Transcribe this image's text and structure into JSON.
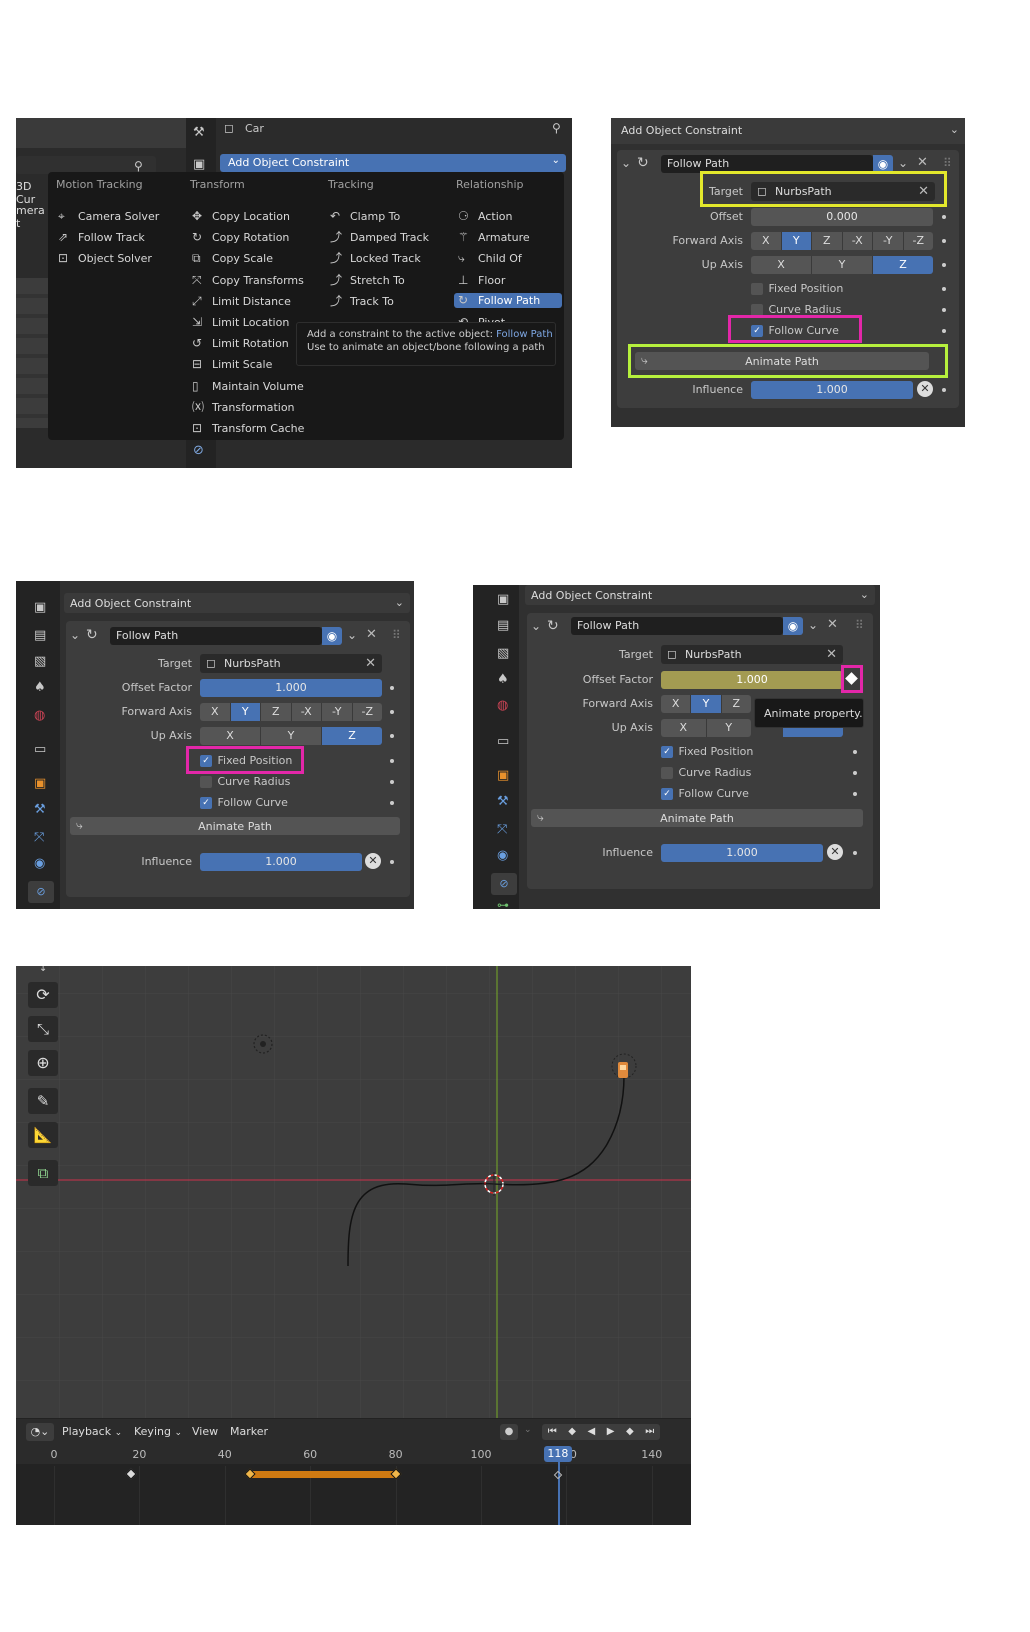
{
  "panel1": {
    "object_name": "Car",
    "menu_title": "Add Object Constraint",
    "left_labels": [
      "3D Cur",
      "mera t"
    ],
    "columns": [
      {
        "title": "Motion Tracking",
        "items": [
          {
            "label": "Camera Solver",
            "icon": "camera-solver-icon",
            "glyph": "⌖"
          },
          {
            "label": "Follow Track",
            "icon": "follow-track-icon",
            "glyph": "⇗"
          },
          {
            "label": "Object Solver",
            "icon": "object-solver-icon",
            "glyph": "⊡"
          }
        ]
      },
      {
        "title": "Transform",
        "items": [
          {
            "label": "Copy Location",
            "icon": "copy-location-icon",
            "glyph": "✥"
          },
          {
            "label": "Copy Rotation",
            "icon": "copy-rotation-icon",
            "glyph": "↻"
          },
          {
            "label": "Copy Scale",
            "icon": "copy-scale-icon",
            "glyph": "⧉"
          },
          {
            "label": "Copy Transforms",
            "icon": "copy-transforms-icon",
            "glyph": "⤧"
          },
          {
            "label": "Limit Distance",
            "icon": "limit-distance-icon",
            "glyph": "⤢"
          },
          {
            "label": "Limit Location",
            "icon": "limit-location-icon",
            "glyph": "⇲"
          },
          {
            "label": "Limit Rotation",
            "icon": "limit-rotation-icon",
            "glyph": "↺"
          },
          {
            "label": "Limit Scale",
            "icon": "limit-scale-icon",
            "glyph": "⊟"
          },
          {
            "label": "Maintain Volume",
            "icon": "maintain-volume-icon",
            "glyph": "▯"
          },
          {
            "label": "Transformation",
            "icon": "transformation-icon",
            "glyph": "⒳"
          },
          {
            "label": "Transform Cache",
            "icon": "transform-cache-icon",
            "glyph": "⊡"
          }
        ]
      },
      {
        "title": "Tracking",
        "items": [
          {
            "label": "Clamp To",
            "icon": "clamp-to-icon",
            "glyph": "↶"
          },
          {
            "label": "Damped Track",
            "icon": "damped-track-icon",
            "glyph": "⤴"
          },
          {
            "label": "Locked Track",
            "icon": "locked-track-icon",
            "glyph": "⤴"
          },
          {
            "label": "Stretch To",
            "icon": "stretch-to-icon",
            "glyph": "⤴"
          },
          {
            "label": "Track To",
            "icon": "track-to-icon",
            "glyph": "⤴"
          }
        ]
      },
      {
        "title": "Relationship",
        "items": [
          {
            "label": "Action",
            "icon": "action-icon",
            "glyph": "⚆"
          },
          {
            "label": "Armature",
            "icon": "armature-icon",
            "glyph": "⚚"
          },
          {
            "label": "Child Of",
            "icon": "child-of-icon",
            "glyph": "⤷"
          },
          {
            "label": "Floor",
            "icon": "floor-icon",
            "glyph": "⊥"
          },
          {
            "label": "Follow Path",
            "icon": "follow-path-icon",
            "glyph": "↻",
            "selected": true
          },
          {
            "label": "Pivot",
            "icon": "pivot-icon",
            "glyph": "⟲"
          }
        ]
      }
    ],
    "tooltip": {
      "prefix": "Add a constraint to the active object:",
      "highlight": "Follow Path",
      "line2": "Use to animate an object/bone following a path"
    }
  },
  "panel2": {
    "header": "Add Object Constraint",
    "constraint_name": "Follow Path",
    "target_label": "Target",
    "target_value": "NurbsPath",
    "offset_label": "Offset",
    "offset_value": "0.000",
    "forward_axis_label": "Forward Axis",
    "forward_axis_options": [
      "X",
      "Y",
      "Z",
      "-X",
      "-Y",
      "-Z"
    ],
    "forward_axis_selected": 1,
    "up_axis_label": "Up Axis",
    "up_axis_options": [
      "X",
      "Y",
      "Z"
    ],
    "up_axis_selected": 2,
    "fixed_position": {
      "label": "Fixed Position",
      "checked": false
    },
    "curve_radius": {
      "label": "Curve Radius",
      "checked": false
    },
    "follow_curve": {
      "label": "Follow Curve",
      "checked": true
    },
    "animate_path": "Animate Path",
    "influence_label": "Influence",
    "influence_value": "1.000",
    "highlight_colors": {
      "target": "#e3e82c",
      "animate": "#b6f03d",
      "follow_curve": "#e327a9"
    }
  },
  "panel3": {
    "header": "Add Object Constraint",
    "constraint_name": "Follow Path",
    "target_label": "Target",
    "target_value": "NurbsPath",
    "offset_label": "Offset Factor",
    "offset_value": "1.000",
    "forward_axis_label": "Forward Axis",
    "forward_axis_options": [
      "X",
      "Y",
      "Z",
      "-X",
      "-Y",
      "-Z"
    ],
    "forward_axis_selected": 1,
    "up_axis_label": "Up Axis",
    "up_axis_options": [
      "X",
      "Y",
      "Z"
    ],
    "up_axis_selected": 2,
    "fixed_position": {
      "label": "Fixed Position",
      "checked": true
    },
    "curve_radius": {
      "label": "Curve Radius",
      "checked": false
    },
    "follow_curve": {
      "label": "Follow Curve",
      "checked": true
    },
    "animate_path": "Animate Path",
    "influence_label": "Influence",
    "influence_value": "1.000"
  },
  "panel4": {
    "header": "Add Object Constraint",
    "constraint_name": "Follow Path",
    "target_label": "Target",
    "target_value": "NurbsPath",
    "offset_label": "Offset Factor",
    "offset_value": "1.000",
    "forward_axis_label": "Forward Axis",
    "forward_axis_options": [
      "X",
      "Y",
      "Z"
    ],
    "forward_axis_selected": 1,
    "up_axis_label": "Up Axis",
    "up_axis_options": [
      "X",
      "Y"
    ],
    "up_axis_selected": 2,
    "tooltip": "Animate property.",
    "fixed_position": {
      "label": "Fixed Position",
      "checked": true
    },
    "curve_radius": {
      "label": "Curve Radius",
      "checked": false
    },
    "follow_curve": {
      "label": "Follow Curve",
      "checked": true
    },
    "animate_path": "Animate Path",
    "influence_label": "Influence",
    "influence_value": "1.000"
  },
  "timeline": {
    "menus": [
      "Playback",
      "Keying",
      "View",
      "Marker"
    ],
    "ticks": [
      "0",
      "20",
      "40",
      "60",
      "80",
      "100",
      "120",
      "140"
    ],
    "current_frame": "118",
    "current_frame_value": 118,
    "keyframes": [
      18,
      46,
      80
    ],
    "accent_color": "#cf7a12"
  }
}
